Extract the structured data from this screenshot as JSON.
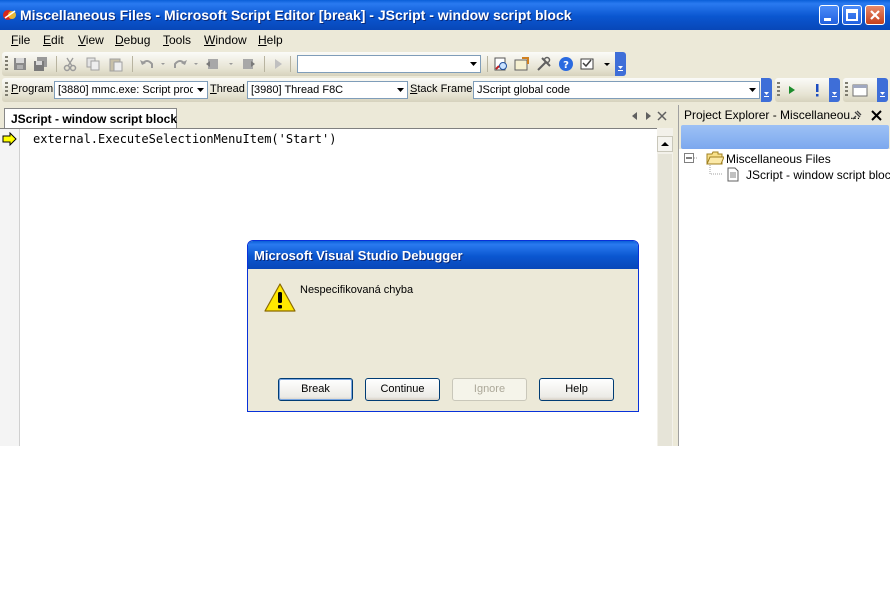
{
  "window": {
    "title": "Miscellaneous Files - Microsoft Script Editor [break] - JScript - window script block"
  },
  "menu": {
    "items": [
      {
        "accel": "F",
        "rest": "ile"
      },
      {
        "accel": "E",
        "rest": "dit"
      },
      {
        "accel": "V",
        "rest": "iew"
      },
      {
        "accel": "D",
        "rest": "ebug"
      },
      {
        "accel": "T",
        "rest": "ools"
      },
      {
        "accel": "W",
        "rest": "indow"
      },
      {
        "accel": "H",
        "rest": "elp"
      }
    ]
  },
  "debug_toolbar": {
    "program_accel": "P",
    "program_rest": "rogram",
    "program_value": "[3880] mmc.exe: Script proc",
    "thread_accel": "T",
    "thread_rest": "hread",
    "thread_value": "[3980] Thread F8C",
    "stack_accel": "S",
    "stack_rest": "tack Frame",
    "stack_value": "JScript global code"
  },
  "editor": {
    "tab_label": "JScript - window script block",
    "code_line": "external.ExecuteSelectionMenuItem('Start')"
  },
  "project_explorer": {
    "title": "Project Explorer - Miscellaneou...",
    "root": "Miscellaneous Files",
    "child": "JScript - window script block"
  },
  "dialog": {
    "title": "Microsoft Visual Studio Debugger",
    "message": "Nespecifikovaná chyba",
    "buttons": {
      "break": "Break",
      "continue": "Continue",
      "ignore": "Ignore",
      "help": "Help"
    }
  },
  "colors": {
    "titlebar": "#0a56d0",
    "accent_blue": "#0831d9",
    "face": "#ece9d8"
  }
}
